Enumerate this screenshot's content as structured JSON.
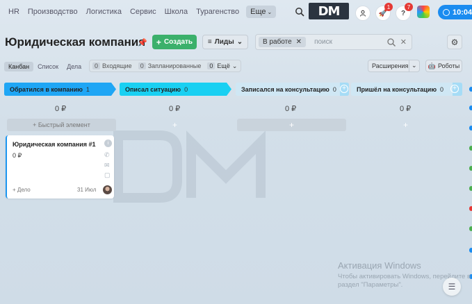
{
  "topnav": {
    "items": [
      "HR",
      "Производство",
      "Логистика",
      "Сервис",
      "Школа",
      "Турагенство"
    ],
    "more_label": "Еще",
    "logo_text": "DM",
    "notifications_badge": "1",
    "help_badge": "7",
    "time": "10:04",
    "accent_color": "#1a8cf0"
  },
  "header": {
    "title": "Юридическая компания",
    "create_label": "Создать",
    "leads_label": "Лиды",
    "filter_chip": "В работе",
    "search_placeholder": "поиск"
  },
  "viewbar": {
    "views": [
      "Канбан",
      "Список",
      "Дела"
    ],
    "active_view": "Канбан",
    "counters": [
      {
        "count": "0",
        "label": "Входящие"
      },
      {
        "count": "0",
        "label": "Запланированные"
      },
      {
        "count": "0",
        "label": "Ещё"
      }
    ],
    "extensions_label": "Расширения",
    "robots_label": "Роботы"
  },
  "columns": [
    {
      "title": "Обратился в компанию",
      "count": "1",
      "sum": "0 ₽",
      "color": "#1fa6f5",
      "add_label": "+ Быстрый элемент"
    },
    {
      "title": "Описал ситуацию",
      "count": "0",
      "sum": "0 ₽",
      "color": "#19d0f2",
      "add_label": "+"
    },
    {
      "title": "Записался на консультацию",
      "count": "0",
      "sum": "0 ₽",
      "color": "#a6dcf6",
      "add_label": "+"
    },
    {
      "title": "Пришёл на консультацию",
      "count": "0",
      "sum": "0 ₽",
      "color": "#a6dcf6",
      "add_label": "+"
    }
  ],
  "card": {
    "title": "Юридическая компания #1",
    "sum": "0 ₽",
    "deal_label": "+ Дело",
    "date": "31 Июл"
  },
  "watermark": {
    "line1": "Активация Windows",
    "line2": "Чтобы активировать Windows, перейдите в",
    "line3": "раздел \"Параметры\"."
  }
}
